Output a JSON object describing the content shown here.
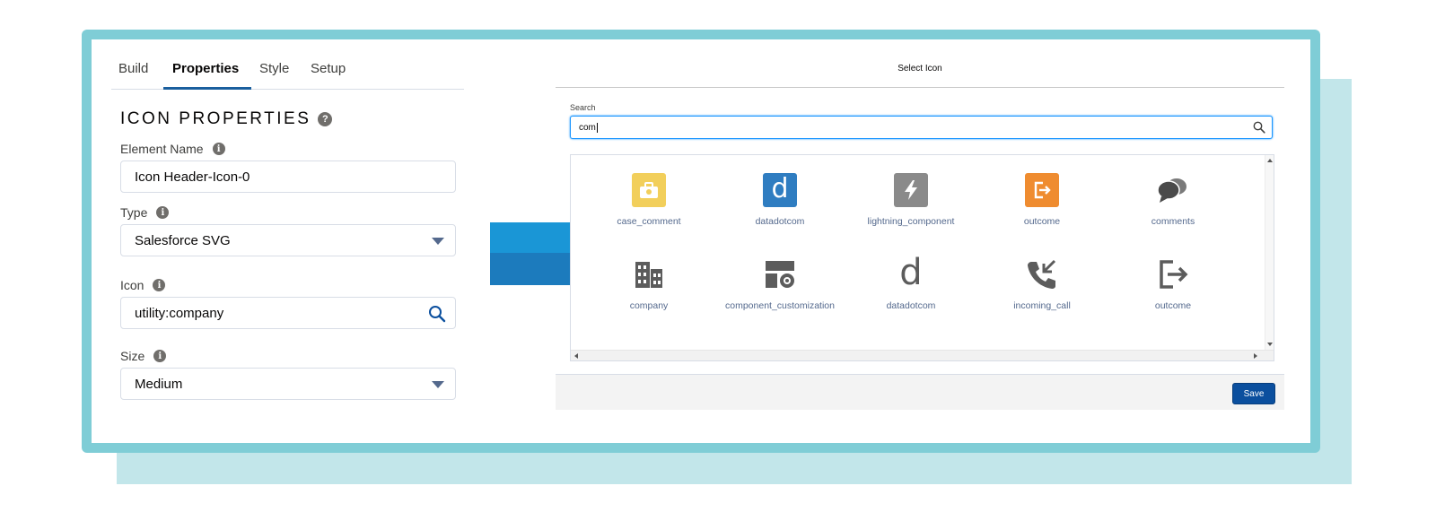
{
  "properties_panel": {
    "tabs": [
      {
        "label": "Build",
        "active": false
      },
      {
        "label": "Properties",
        "active": true
      },
      {
        "label": "Style",
        "active": false
      },
      {
        "label": "Setup",
        "active": false
      }
    ],
    "section_title": "ICON PROPERTIES",
    "help_icon": "question-circle-icon",
    "fields": {
      "element_name": {
        "label": "Element Name",
        "value": "Icon Header-Icon-0"
      },
      "type": {
        "label": "Type",
        "value": "Salesforce SVG"
      },
      "icon": {
        "label": "Icon",
        "value": "utility:company"
      },
      "size": {
        "label": "Size",
        "value": "Medium"
      }
    }
  },
  "select_icon_dialog": {
    "title": "Select Icon",
    "search_label": "Search",
    "search_value": "com",
    "icons": [
      {
        "label": "case_comment",
        "icon": "case-comment-icon",
        "color": "#f2cf5b"
      },
      {
        "label": "datadotcom",
        "icon": "datadotcom-icon",
        "color": "#2f7dc1",
        "glyph": "d"
      },
      {
        "label": "lightning_component",
        "icon": "lightning-bolt-icon",
        "color": "#8a8a8a"
      },
      {
        "label": "outcome",
        "icon": "outcome-exit-icon",
        "color": "#ef8c30"
      },
      {
        "label": "comments",
        "icon": "comments-icon",
        "color": "#5c5c5c"
      },
      {
        "label": "company",
        "icon": "company-building-icon",
        "color": "#5c5c5c"
      },
      {
        "label": "component_customization",
        "icon": "component-customization-icon",
        "color": "#5c5c5c"
      },
      {
        "label": "datadotcom",
        "icon": "datadotcom-icon",
        "color": "#5c5c5c",
        "glyph": "d"
      },
      {
        "label": "incoming_call",
        "icon": "incoming-call-icon",
        "color": "#5c5c5c"
      },
      {
        "label": "outcome",
        "icon": "outcome-exit-icon",
        "color": "#5c5c5c"
      }
    ],
    "save_label": "Save"
  },
  "colors": {
    "frame": "#7fcdd6",
    "shadow": "#c2e6ea",
    "arrow_top": "#1a96d6",
    "arrow_bottom": "#1c7bbd",
    "save_button": "#0b4f9e",
    "tab_underline": "#1b5f9e"
  }
}
